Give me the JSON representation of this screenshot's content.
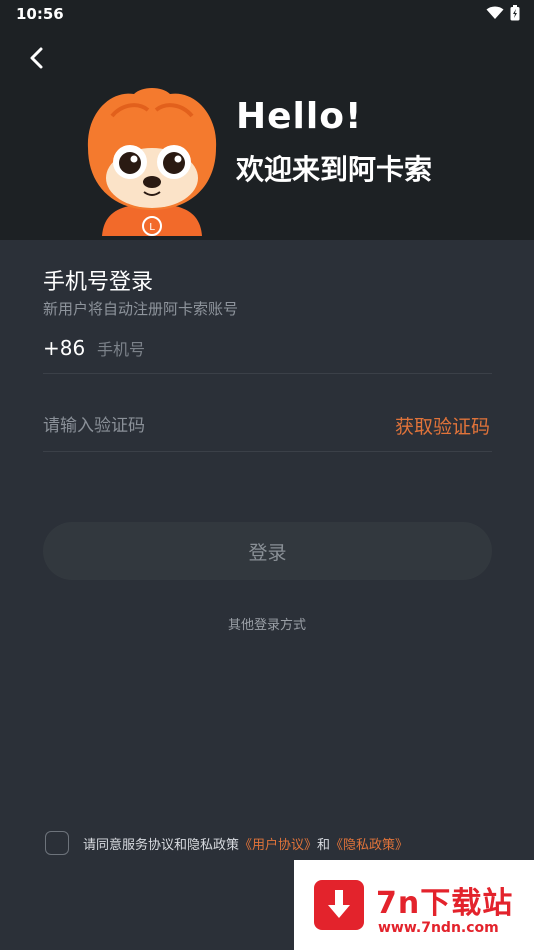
{
  "status_bar": {
    "time": "10:56",
    "icons": [
      "wifi-icon",
      "battery-icon"
    ]
  },
  "header": {
    "back_icon": "chevron-left-icon",
    "greeting": "Hello!",
    "welcome": "欢迎来到阿卡索",
    "mascot_icon": "fox-mascot-icon",
    "background_color": "#1d2124"
  },
  "form": {
    "title": "手机号登录",
    "subtitle": "新用户将自动注册阿卡索账号",
    "country_code": "+86",
    "phone_placeholder": "手机号",
    "code_placeholder": "请输入验证码",
    "get_code_label": "获取验证码"
  },
  "actions": {
    "login_label": "登录",
    "other_login_label": "其他登录方式"
  },
  "agreement": {
    "prefix": "请同意服务协议和隐私政策",
    "user_agreement": "《用户协议》",
    "connector": "和",
    "privacy_policy": "《隐私政策》"
  },
  "watermark": {
    "title": "7n下载站",
    "url": "www.7ndn.com"
  },
  "colors": {
    "accent": "#e0733a",
    "page_background": "#2b3038"
  }
}
